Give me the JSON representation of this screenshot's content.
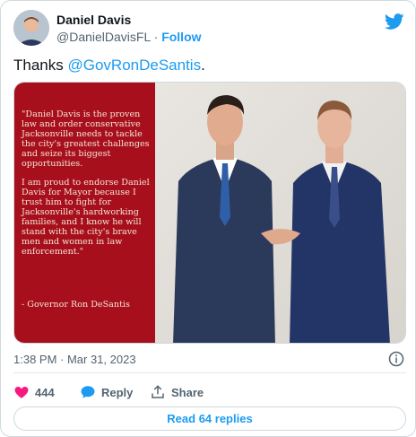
{
  "author": {
    "name": "Daniel Davis",
    "handle": "@DanielDavisFL",
    "separator": "·",
    "follow_label": "Follow"
  },
  "tweet": {
    "text_prefix": "Thanks ",
    "mention": "@GovRonDeSantis",
    "text_suffix": "."
  },
  "media": {
    "quote_paragraph_1": "\"Daniel Davis is the proven law and order conservative Jacksonville needs to tackle the city's greatest challenges and seize its biggest opportunities.",
    "quote_paragraph_2": "I am proud to endorse Daniel Davis for Mayor because I trust him to fight for Jacksonville's hardworking families, and I know he will stand with the city's brave men and women in law enforcement.\"",
    "quote_attribution": "- Governor Ron DeSantis"
  },
  "timestamp": "1:38 PM · Mar 31, 2023",
  "actions": {
    "like_count": "444",
    "reply_label": "Reply",
    "share_label": "Share"
  },
  "read_replies_label": "Read 64 replies",
  "colors": {
    "accent": "#1d9bf0",
    "like": "#f91880",
    "quote_panel": "#a80f1c"
  }
}
